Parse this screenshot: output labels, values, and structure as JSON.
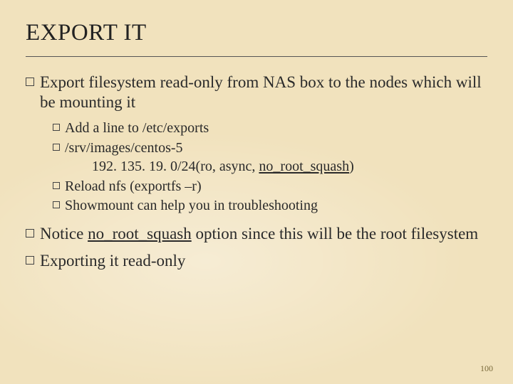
{
  "title": "EXPORT IT",
  "page_number": "100",
  "bullets": [
    {
      "text": "Export filesystem read-only from NAS box to the nodes which will be mounting it",
      "children": [
        {
          "text": "Add a line to /etc/exports"
        },
        {
          "text": "/srv/images/centos-5",
          "continuation_prefix": "192. 135. 19. 0/24(ro, async, ",
          "continuation_underlined": "no_root_squash",
          "continuation_suffix": ")"
        },
        {
          "text": "Reload nfs (exportfs –r)"
        },
        {
          "text": "Showmount can help you in troubleshooting"
        }
      ]
    },
    {
      "text_prefix": "Notice ",
      "text_underlined": "no_root_squash",
      "text_suffix": " option since this will be the root filesystem"
    },
    {
      "text": "Exporting it read-only"
    }
  ]
}
